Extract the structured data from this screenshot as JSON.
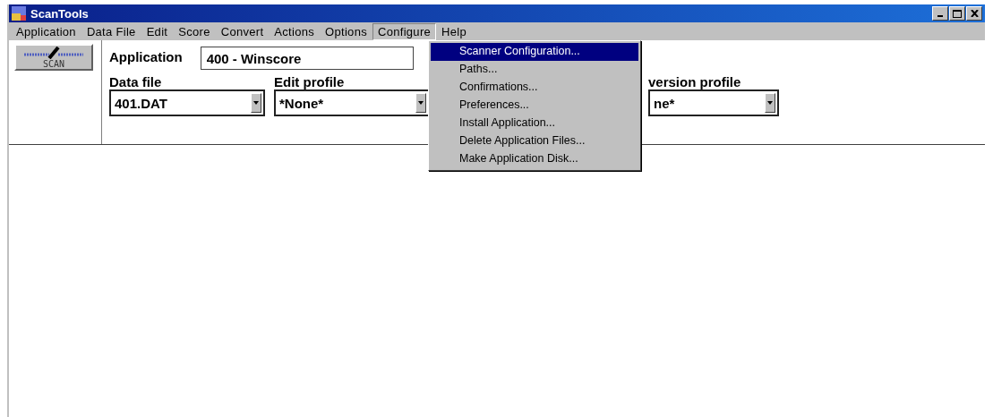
{
  "window": {
    "title": "ScanTools"
  },
  "menu_bar": [
    {
      "label": "Application",
      "selected": false
    },
    {
      "label": "Data File",
      "selected": false
    },
    {
      "label": "Edit",
      "selected": false
    },
    {
      "label": "Score",
      "selected": false
    },
    {
      "label": "Convert",
      "selected": false
    },
    {
      "label": "Actions",
      "selected": false
    },
    {
      "label": "Options",
      "selected": false
    },
    {
      "label": "Configure",
      "selected": true
    },
    {
      "label": "Help",
      "selected": false
    }
  ],
  "toolbar": {
    "scan_button": "SCAN",
    "application_label": "Application",
    "application_value": "400 - Winscore",
    "combos": [
      {
        "label": "Data file",
        "value": "401.DAT"
      },
      {
        "label": "Edit profile",
        "value": "*None*"
      },
      {
        "label": "version profile",
        "value": "ne*"
      }
    ]
  },
  "dropdown": [
    {
      "label": "Scanner Configuration...",
      "selected": true
    },
    {
      "label": "Paths...",
      "selected": false
    },
    {
      "label": "Confirmations...",
      "selected": false
    },
    {
      "label": "Preferences...",
      "selected": false
    },
    {
      "label": "Install Application...",
      "selected": false
    },
    {
      "label": "Delete Application Files...",
      "selected": false
    },
    {
      "label": "Make Application Disk...",
      "selected": false
    }
  ]
}
